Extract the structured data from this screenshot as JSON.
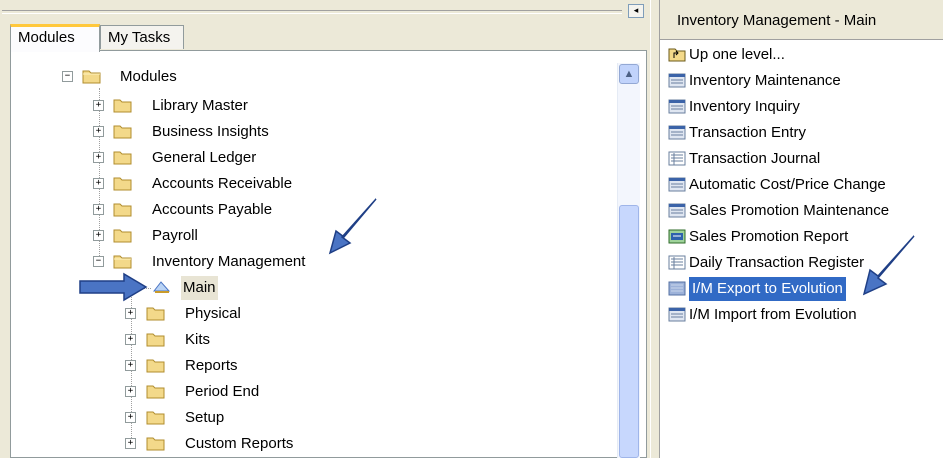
{
  "left": {
    "tabs": [
      "Modules",
      "My Tasks"
    ],
    "tree": [
      {
        "label": "Modules",
        "level": 0,
        "expander": "−"
      },
      {
        "label": "Library Master",
        "level": 1,
        "expander": "+"
      },
      {
        "label": "Business Insights",
        "level": 1,
        "expander": "+"
      },
      {
        "label": "General Ledger",
        "level": 1,
        "expander": "+"
      },
      {
        "label": "Accounts Receivable",
        "level": 1,
        "expander": "+"
      },
      {
        "label": "Accounts Payable",
        "level": 1,
        "expander": "+"
      },
      {
        "label": "Payroll",
        "level": 1,
        "expander": "+"
      },
      {
        "label": "Inventory Management",
        "level": 1,
        "expander": "−"
      },
      {
        "label": "Main",
        "level": 2,
        "expander": ""
      },
      {
        "label": "Physical",
        "level": 2,
        "expander": "+"
      },
      {
        "label": "Kits",
        "level": 2,
        "expander": "+"
      },
      {
        "label": "Reports",
        "level": 2,
        "expander": "+"
      },
      {
        "label": "Period End",
        "level": 2,
        "expander": "+"
      },
      {
        "label": "Setup",
        "level": 2,
        "expander": "+"
      },
      {
        "label": "Custom Reports",
        "level": 2,
        "expander": "+"
      }
    ]
  },
  "right": {
    "header": "Inventory Management - Main",
    "tasks": [
      {
        "label": "Up one level...",
        "icon": "up-folder-icon"
      },
      {
        "label": "Inventory Maintenance",
        "icon": "form-icon"
      },
      {
        "label": "Inventory Inquiry",
        "icon": "form-icon"
      },
      {
        "label": "Transaction Entry",
        "icon": "form-icon"
      },
      {
        "label": "Transaction Journal",
        "icon": "report-icon"
      },
      {
        "label": "Automatic Cost/Price Change",
        "icon": "form-icon"
      },
      {
        "label": "Sales Promotion Maintenance",
        "icon": "form-icon"
      },
      {
        "label": "Sales Promotion Report",
        "icon": "report-special-icon"
      },
      {
        "label": "Daily Transaction Register",
        "icon": "report-icon"
      },
      {
        "label": "I/M Export to Evolution",
        "icon": "export-icon"
      },
      {
        "label": "I/M Import from Evolution",
        "icon": "form-icon"
      }
    ]
  },
  "colors": {
    "selection": "#316ac5",
    "arrow": "#4a74c4",
    "folder": "#f3d98a"
  }
}
